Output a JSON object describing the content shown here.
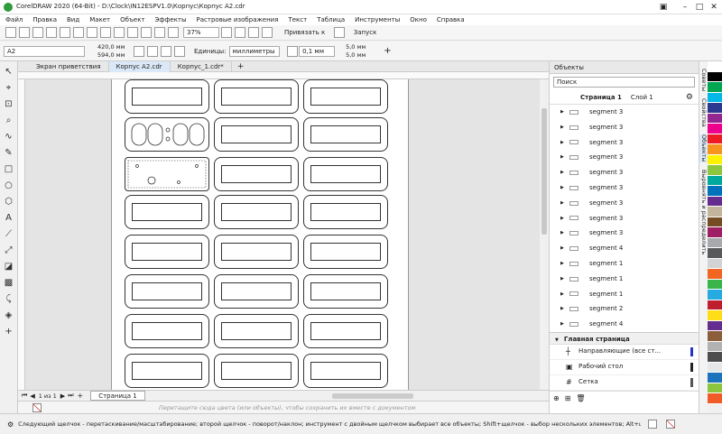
{
  "window": {
    "title": "CorelDRAW 2020 (64-Bit) - D:\\Clock\\IN12ESPV1.0\\Корпус\\Корпус A2.cdr",
    "minimize": "–",
    "maximize": "□",
    "close": "✕"
  },
  "menu": [
    "Файл",
    "Правка",
    "Вид",
    "Макет",
    "Объект",
    "Эффекты",
    "Растровые изображения",
    "Текст",
    "Таблица",
    "Инструменты",
    "Окно",
    "Справка"
  ],
  "toolbar": {
    "zoom": "37%",
    "snap_label": "Привязать к",
    "launch_label": "Запуск"
  },
  "property_bar": {
    "page_size": "A2",
    "width": "420,0 мм",
    "height": "594,0 мм",
    "units_label": "Единицы:",
    "units": "миллиметры",
    "nudge": "0,1 мм",
    "dup_x": "5,0 мм",
    "dup_y": "5,0 мм"
  },
  "tabs": [
    {
      "label": "Экран приветствия"
    },
    {
      "label": "Корпус A2.cdr"
    },
    {
      "label": "Корпус_1.cdr*"
    }
  ],
  "pagebar": {
    "page_count": "1 из 1",
    "page_tab": "Страница 1"
  },
  "colorbar_hint": "Перетащите сюда цвета (или объекты), чтобы сохранить их вместе с документом",
  "status": "Следующий щелчок - перетаскивание/масштабирование; второй щелчок - поворот/наклон; инструмент с двойным щелчком выбирает все объекты; Shift+щелчок - выбор нескольких элементов; Alt+щелчок - цифры",
  "panel": {
    "title": "Объекты",
    "search_placeholder": "Поиск",
    "page": "Страница 1",
    "layer": "Слой 1",
    "objects": [
      "segment 3",
      "segment 3",
      "segment 3",
      "segment 3",
      "segment 3",
      "segment 3",
      "segment 3",
      "segment 3",
      "segment 3",
      "segment 4",
      "segment 1",
      "segment 1",
      "segment 1",
      "segment 2",
      "segment 4"
    ],
    "master_title": "Главная страница",
    "master_items": [
      "Направляющие (все ст...",
      "Рабочий стол",
      "Сетка"
    ]
  },
  "docker_tabs": [
    "Советы",
    "Свойства",
    "Объекты",
    "Выровнять и распределить"
  ],
  "palette": [
    "#ffffff",
    "#000000",
    "#00a651",
    "#00b8e6",
    "#2b3990",
    "#92278f",
    "#ec008c",
    "#ed1c24",
    "#f7941d",
    "#fff200",
    "#8dc63f",
    "#00a99d",
    "#0072bc",
    "#662d91",
    "#c2b59b",
    "#754c24",
    "#9e1f63",
    "#a7a9ac",
    "#58595b",
    "#d1d3d4",
    "#f26522",
    "#39b54a",
    "#27aae1",
    "#be1e2d",
    "#ffde17",
    "#662d91",
    "#8b5e3c",
    "#b2b2b2",
    "#4d4d4d",
    "#e6e7e8",
    "#1c75bc",
    "#8cc63f",
    "#f15a29"
  ]
}
